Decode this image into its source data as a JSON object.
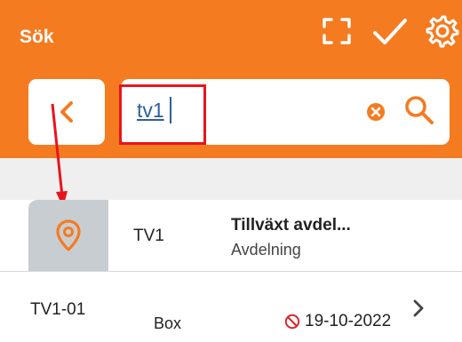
{
  "header": {
    "title": "Sök",
    "icons": [
      "fullscreen-icon",
      "check-icon",
      "gear-icon"
    ],
    "color": "#f47b20"
  },
  "search": {
    "value": "tv1",
    "highlight_color": "#e8141c"
  },
  "results": [
    {
      "code": "TV1",
      "name": "Tillväxt avdel...",
      "type": "Avdelning",
      "icon": "location-pin-icon"
    },
    {
      "code": "TV1-01",
      "type": "Box",
      "date": "19-10-2022",
      "status_icon": "blocked-icon"
    }
  ]
}
